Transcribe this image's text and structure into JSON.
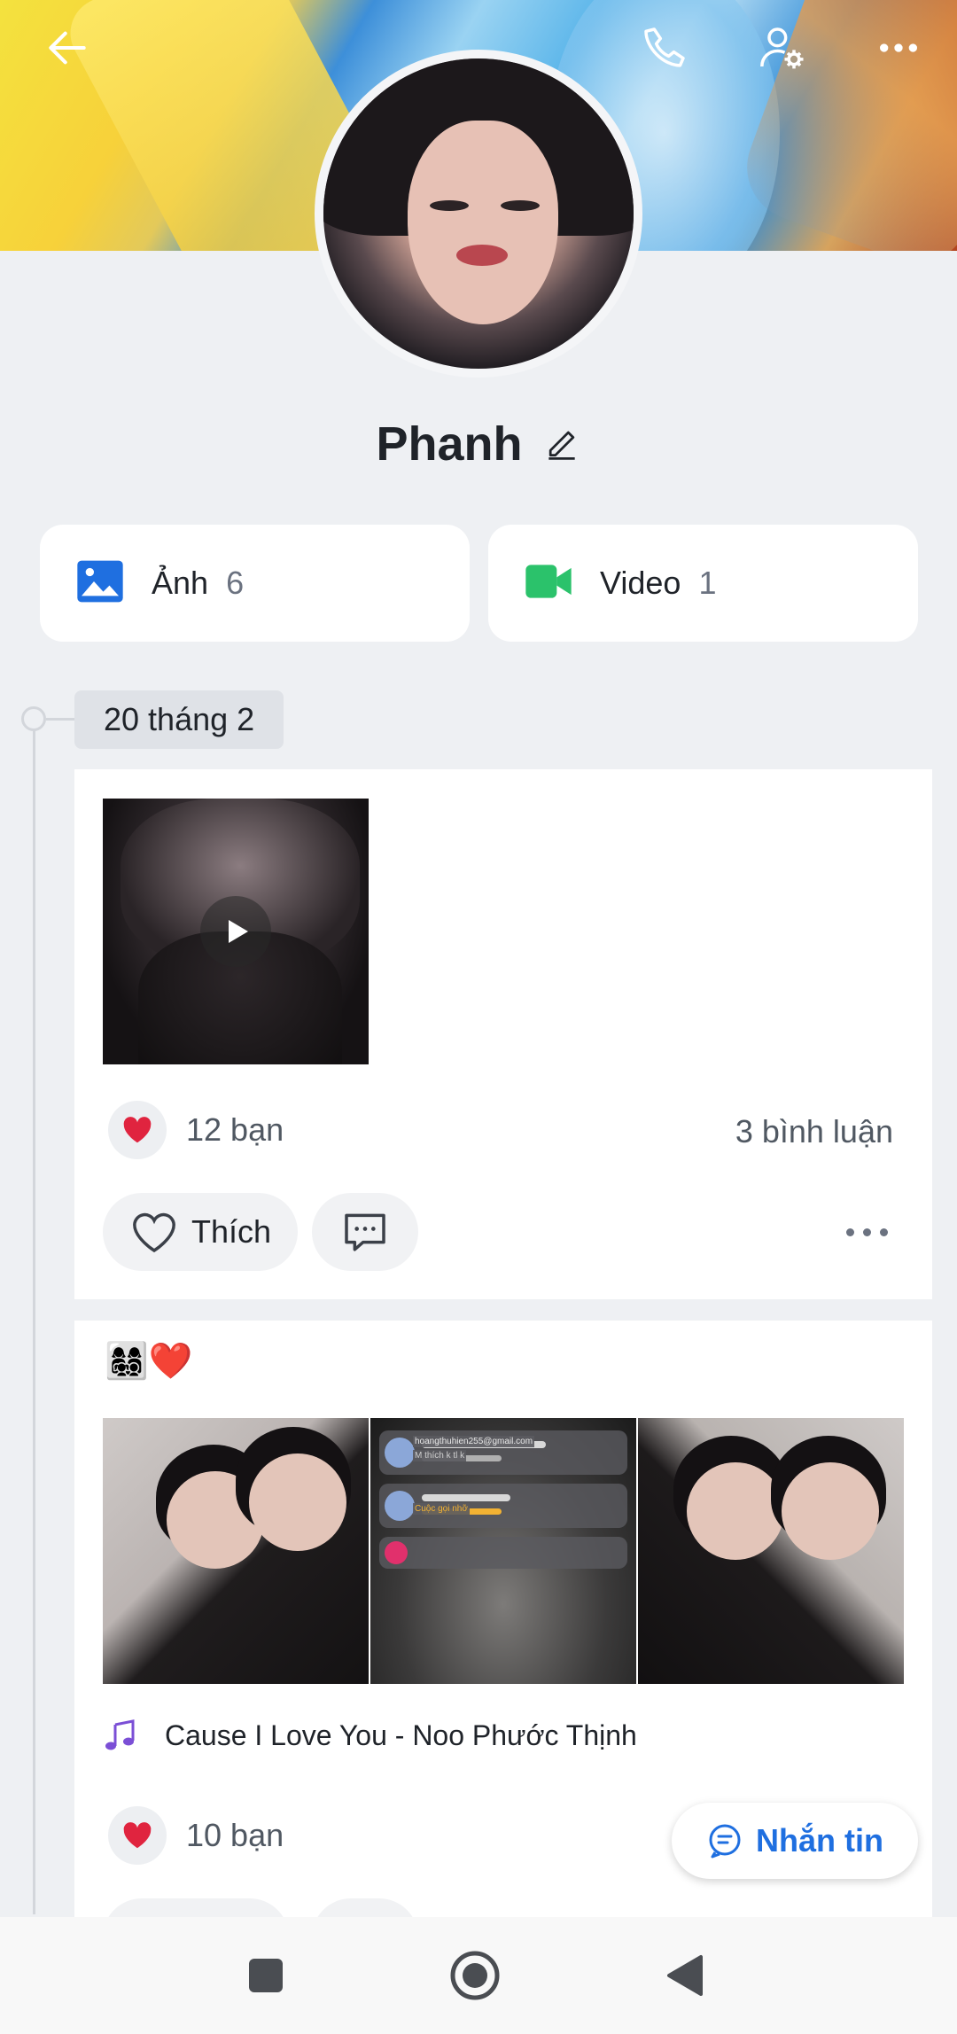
{
  "header": {
    "icons": [
      "back-arrow-icon",
      "phone-icon",
      "profile-settings-icon",
      "more-dots-icon"
    ]
  },
  "profile": {
    "name": "Phanh"
  },
  "media_tiles": [
    {
      "label": "Ảnh",
      "count": "6",
      "icon": "photo-icon",
      "color": "#1f6fe0"
    },
    {
      "label": "Video",
      "count": "1",
      "icon": "video-camera-icon",
      "color": "#2bc26b"
    }
  ],
  "timeline": {
    "date": "20 tháng 2"
  },
  "post1": {
    "reactions": "12 bạn",
    "comments": "3 bình luận",
    "like_label": "Thích"
  },
  "post2": {
    "status": "👩‍👩‍👧‍👦❤️",
    "notif1_email": "hoangthuhien255@gmail.com",
    "notif1_text": "M thích k tl k",
    "notif2_text": "Cuộc gọi nhỡ",
    "music": "Cause I Love You - Noo Phước Thịnh",
    "reactions": "10 bạn"
  },
  "fab": {
    "label": "Nhắn tin"
  },
  "colors": {
    "accent": "#1f6fe0",
    "heart": "#e0243f",
    "music": "#7b4fd6"
  }
}
